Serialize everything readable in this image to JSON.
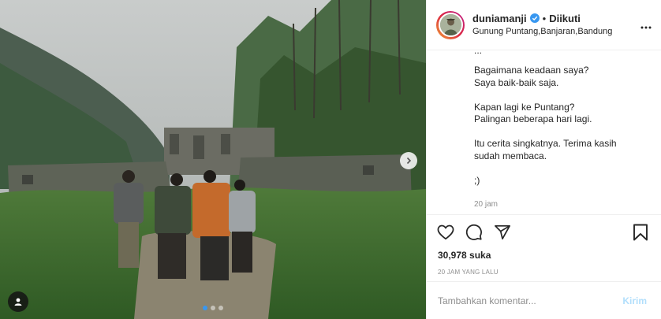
{
  "header": {
    "username": "duniamanji",
    "separator": "•",
    "follow_status": "Diikuti",
    "location": "Gunung Puntang,Banjaran,Bandung"
  },
  "caption": {
    "cut_line": "...",
    "text": "Bagaimana keadaan saya?\nSaya baik-baik saja.\n\nKapan lagi ke Puntang?\nPalingan beberapa hari lagi.\n\nItu cerita singkatnya. Terima kasih\nsudah membaca.\n\n;)",
    "time": "20 jam"
  },
  "actions": {
    "likes": "30,978 suka",
    "posted_ago": "20 JAM YANG LALU"
  },
  "comment": {
    "placeholder": "Tambahkan komentar...",
    "post_label": "Kirim"
  },
  "carousel": {
    "total_slides": 3,
    "active_slide": 1
  },
  "colors": {
    "accent": "#3897f0",
    "verified": "#3897f0",
    "post_disabled": "#b2dffc",
    "muted": "#8e8e8e"
  },
  "icons": [
    "verified-icon",
    "more-options-icon",
    "heart-icon",
    "comment-icon",
    "share-icon",
    "bookmark-icon",
    "next-arrow-icon",
    "user-tag-icon"
  ]
}
